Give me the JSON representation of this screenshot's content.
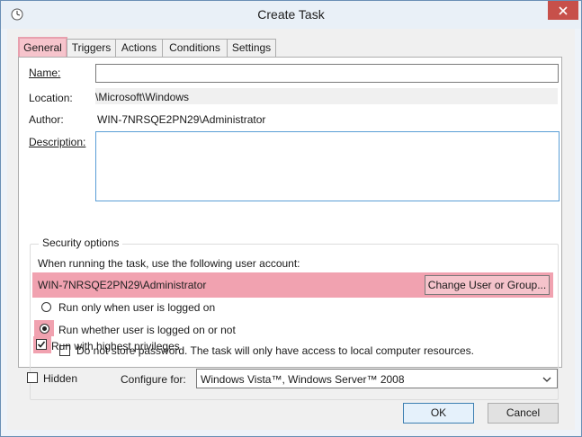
{
  "window": {
    "title": "Create Task"
  },
  "tabs": [
    {
      "label": "General",
      "active": true
    },
    {
      "label": "Triggers",
      "active": false
    },
    {
      "label": "Actions",
      "active": false
    },
    {
      "label": "Conditions",
      "active": false
    },
    {
      "label": "Settings",
      "active": false
    }
  ],
  "general": {
    "name_label": "Name:",
    "name_value": "",
    "location_label": "Location:",
    "location_value": "\\Microsoft\\Windows",
    "author_label": "Author:",
    "author_value": "WIN-7NRSQE2PN29\\Administrator",
    "description_label": "Description:",
    "description_value": ""
  },
  "security": {
    "group_title": "Security options",
    "account_prompt": "When running the task, use the following user account:",
    "account_value": "WIN-7NRSQE2PN29\\Administrator",
    "change_button": "Change User or Group...",
    "radio_logged_on": "Run only when user is logged on",
    "radio_whether": "Run whether user is logged on or not",
    "no_store_password": "Do not store password.  The task will only have access to local computer resources.",
    "highest_privileges": "Run with highest privileges"
  },
  "footer": {
    "hidden_label": "Hidden",
    "configure_label": "Configure for:",
    "configure_value": "Windows Vista™, Windows Server™ 2008",
    "ok_button": "OK",
    "cancel_button": "Cancel"
  },
  "state": {
    "run_only_logged_on": false,
    "run_whether_logged_on": true,
    "do_not_store_password": false,
    "run_highest_privileges": true,
    "hidden": false
  },
  "colors": {
    "highlight": "#f1a2b0",
    "close_button": "#c7504a"
  },
  "icons": {
    "title": "clock-icon",
    "close": "close-icon",
    "dropdown": "chevron-down-icon",
    "check": "checkmark-icon"
  }
}
